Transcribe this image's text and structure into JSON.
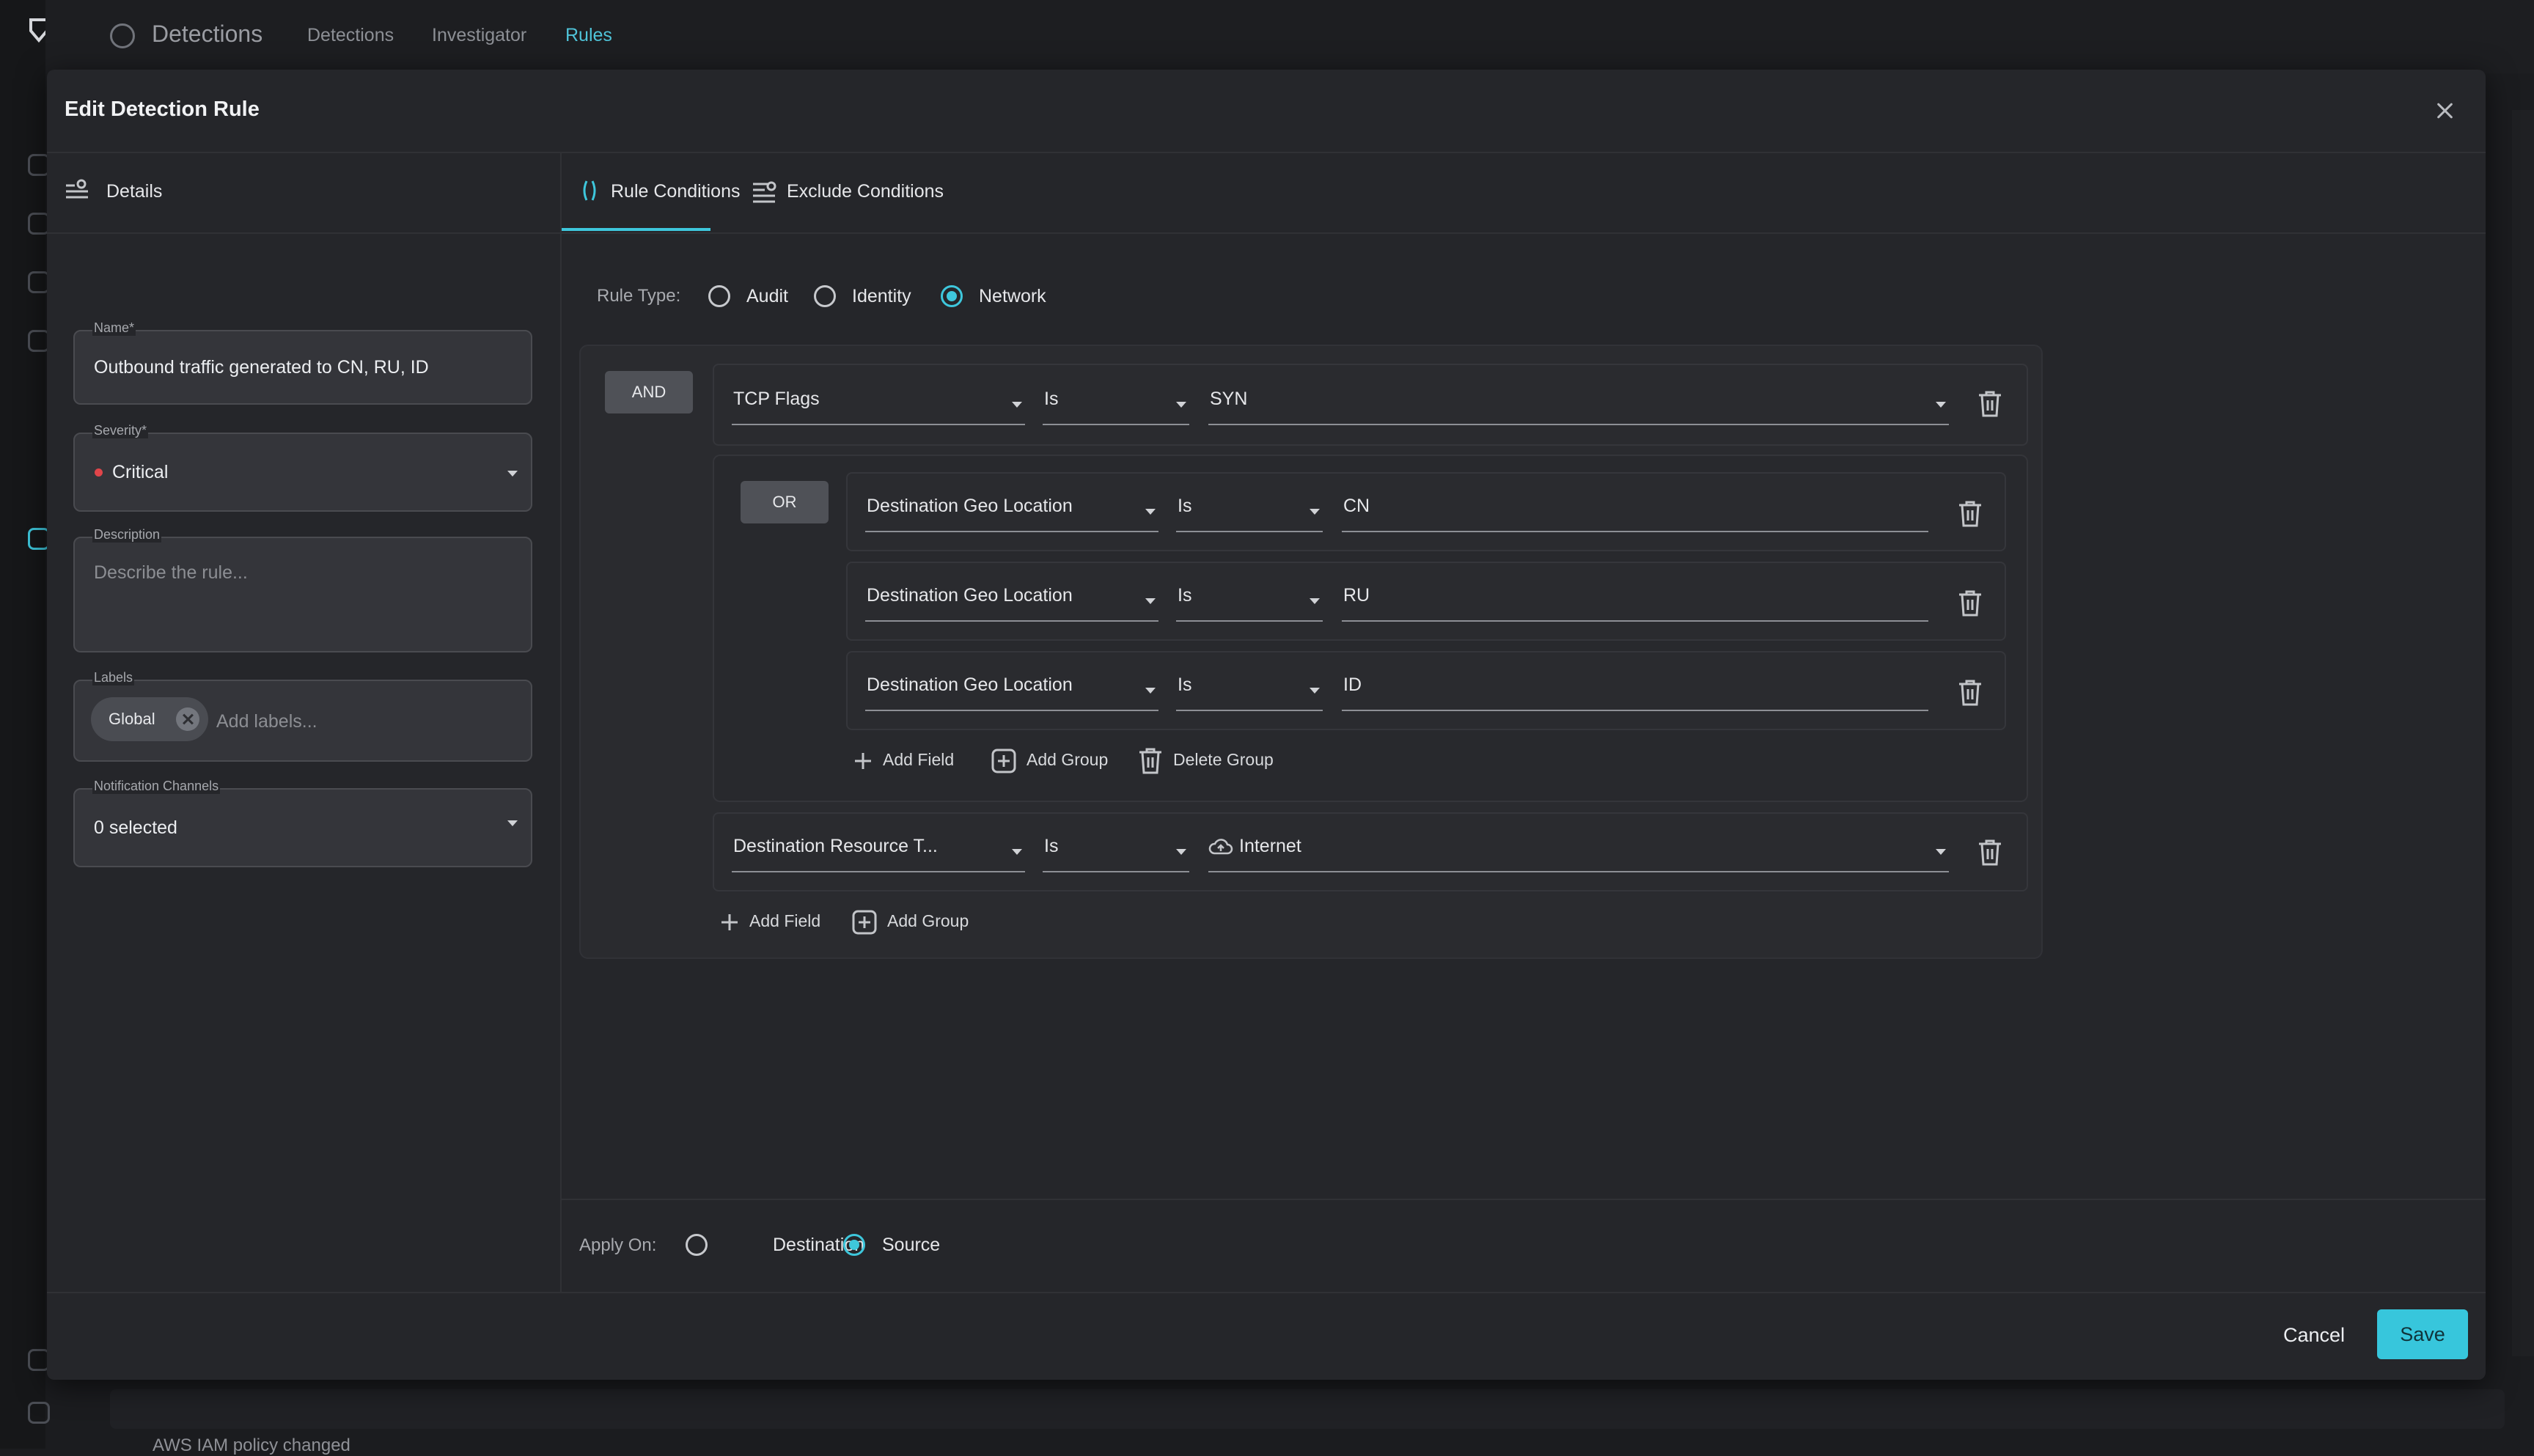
{
  "background": {
    "app_title": "Detections",
    "nav": [
      "Detections",
      "Investigator",
      "Rules"
    ],
    "active_nav": "Rules",
    "row_text": "AWS IAM policy changed"
  },
  "modal": {
    "title": "Edit Detection Rule",
    "left_tab": "Details",
    "fields": {
      "name_label": "Name*",
      "name_value": "Outbound traffic generated to CN, RU, ID",
      "severity_label": "Severity*",
      "severity_value": "Critical",
      "description_label": "Description",
      "description_placeholder": "Describe the rule...",
      "labels_label": "Labels",
      "label_chip": "Global",
      "labels_placeholder": "Add labels...",
      "notification_label": "Notification Channels",
      "notification_value": "0 selected"
    },
    "tabs": [
      "Rule Conditions",
      "Exclude Conditions"
    ],
    "rule_type": {
      "label": "Rule Type:",
      "options": [
        "Audit",
        "Identity",
        "Network"
      ],
      "selected": "Network"
    },
    "conditions": {
      "root_operator": "AND",
      "row1": {
        "field": "TCP Flags",
        "op": "Is",
        "value": "SYN"
      },
      "group": {
        "operator": "OR",
        "rows": [
          {
            "field": "Destination Geo Location",
            "op": "Is",
            "value": "CN"
          },
          {
            "field": "Destination Geo Location",
            "op": "Is",
            "value": "RU"
          },
          {
            "field": "Destination Geo Location",
            "op": "Is",
            "value": "ID"
          }
        ],
        "actions": [
          "Add Field",
          "Add Group",
          "Delete Group"
        ]
      },
      "row2": {
        "field": "Destination Resource T...",
        "op": "Is",
        "value": "Internet"
      },
      "actions": [
        "Add Field",
        "Add Group"
      ]
    },
    "apply_on": {
      "label": "Apply On:",
      "options": [
        "Destination",
        "Source"
      ],
      "selected": "Source"
    },
    "footer": {
      "cancel": "Cancel",
      "save": "Save"
    }
  },
  "colors": {
    "accent": "#3ec7dc",
    "critical": "#e0454a",
    "modal_bg": "#25262a"
  }
}
